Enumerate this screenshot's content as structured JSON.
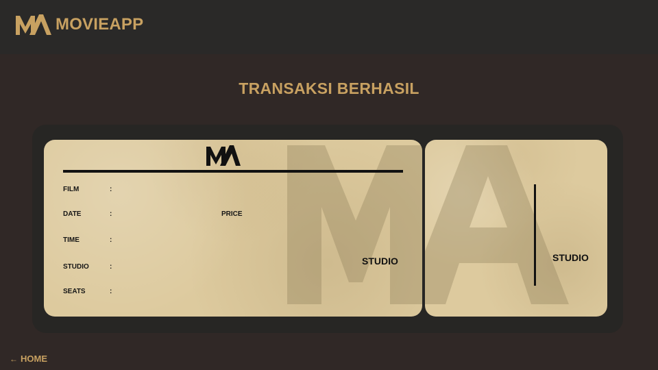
{
  "app": {
    "brand_name": "MOVIEAPP",
    "accent_color": "#c8a161",
    "logo_icon": "ma-logo-icon"
  },
  "page": {
    "title": "TRANSAKSI BERHASIL"
  },
  "ticket": {
    "fields": [
      {
        "label": "FILM",
        "separator": ":"
      },
      {
        "label": "DATE",
        "separator": ":"
      },
      {
        "label": "TIME",
        "separator": ":"
      },
      {
        "label": "STUDIO",
        "separator": ":"
      },
      {
        "label": "SEATS",
        "separator": ":"
      }
    ],
    "price_label": "PRICE",
    "studio_label": "STUDIO",
    "stub": {
      "studio_label": "STUDIO"
    }
  },
  "nav": {
    "home_label": "HOME",
    "home_icon": "arrow-left-icon"
  }
}
